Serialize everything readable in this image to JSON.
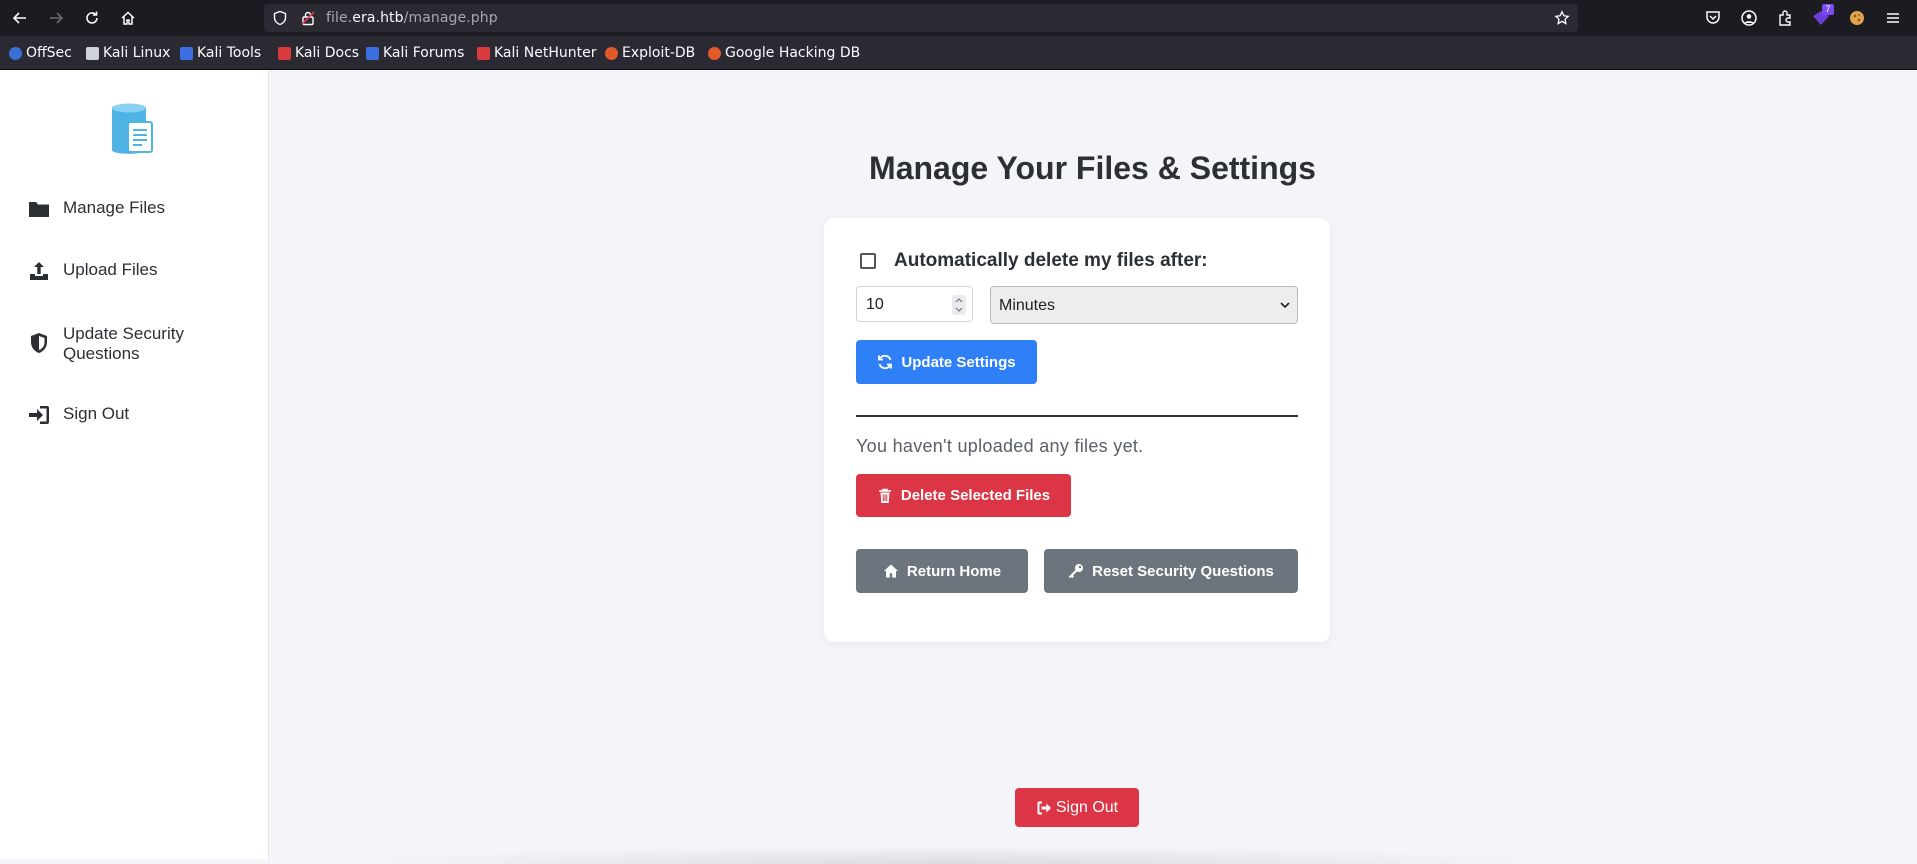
{
  "browser": {
    "url_host_prefix": "file.",
    "url_host": "era.htb",
    "url_path": "/manage.php",
    "extension_badge": "7",
    "bookmarks": [
      {
        "label": "OffSec",
        "color": "#3b6fd8"
      },
      {
        "label": "Kali Linux",
        "color": "#cfd2d8"
      },
      {
        "label": "Kali Tools",
        "color": "#3d6ee0"
      },
      {
        "label": "Kali Docs",
        "color": "#d83b3b"
      },
      {
        "label": "Kali Forums",
        "color": "#3d6ee0"
      },
      {
        "label": "Kali NetHunter",
        "color": "#d83b3b"
      },
      {
        "label": "Exploit-DB",
        "color": "#e05a2a"
      },
      {
        "label": "Google Hacking DB",
        "color": "#e05a2a"
      }
    ]
  },
  "sidebar": {
    "items": [
      {
        "label": "Manage Files",
        "icon": "folder-icon"
      },
      {
        "label": "Upload Files",
        "icon": "upload-icon"
      },
      {
        "label": "Update Security Questions",
        "icon": "shield-icon"
      },
      {
        "label": "Sign Out",
        "icon": "sign-in-icon"
      }
    ]
  },
  "main": {
    "title": "Manage Your Files & Settings",
    "auto_delete_label": "Automatically delete my files after:",
    "auto_delete_value": "10",
    "auto_delete_unit": "Minutes",
    "update_button": "Update Settings",
    "empty_message": "You haven't uploaded any files yet.",
    "delete_button": "Delete Selected Files",
    "return_home_button": "Return Home",
    "reset_security_button": "Reset Security Questions",
    "sign_out_button": "Sign Out"
  },
  "colors": {
    "primary": "#2f80f7",
    "danger": "#dc3545",
    "secondary": "#6c757d",
    "logo": "#4fb3e6"
  }
}
